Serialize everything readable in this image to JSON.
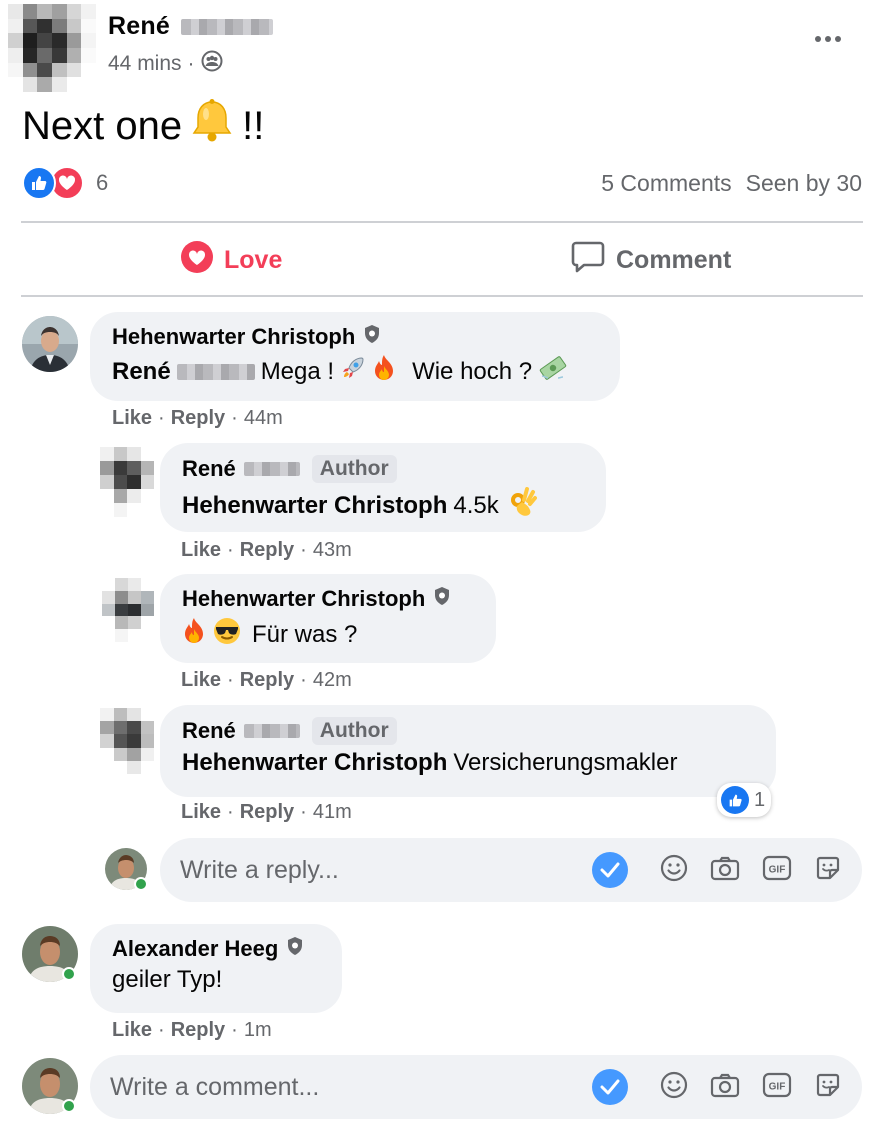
{
  "post": {
    "author": "René",
    "time": "44 mins",
    "separator": "·",
    "text": "Next one",
    "exclamation": "!!",
    "reaction_count": "6",
    "comments_count": "5 Comments",
    "seen_by": "Seen by 30"
  },
  "actions": {
    "love": "Love",
    "comment": "Comment"
  },
  "comments": [
    {
      "name": "Hehenwarter Christoph",
      "mention": "René",
      "text1": "Mega !",
      "text2": "Wie hoch ?",
      "like": "Like",
      "reply": "Reply",
      "time": "44m"
    },
    {
      "name": "René",
      "tag": "Author",
      "mention": "Hehenwarter Christoph",
      "text": "4.5k",
      "like": "Like",
      "reply": "Reply",
      "time": "43m"
    },
    {
      "name": "Hehenwarter Christoph",
      "text": "Für was ?",
      "like": "Like",
      "reply": "Reply",
      "time": "42m"
    },
    {
      "name": "René",
      "tag": "Author",
      "mention": "Hehenwarter Christoph",
      "text": "Versicherungsmakler",
      "reaction_count": "1",
      "like": "Like",
      "reply": "Reply",
      "time": "41m"
    },
    {
      "name": "Alexander Heeg",
      "text": "geiler Typ!",
      "like": "Like",
      "reply": "Reply",
      "time": "1m"
    }
  ],
  "reply_composer": {
    "placeholder": "Write a reply..."
  },
  "comment_composer": {
    "placeholder": "Write a comment..."
  },
  "colors": {
    "love": "#f33e58",
    "like": "#1877f2",
    "online": "#31a24c",
    "bubble": "#f0f2f5"
  }
}
